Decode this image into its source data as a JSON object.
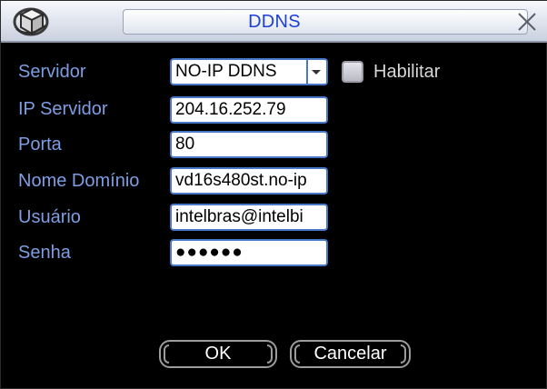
{
  "window": {
    "title": "DDNS",
    "logo_icon": "dahua-cube-logo-icon",
    "close_icon": "close-x-icon"
  },
  "form": {
    "servidor": {
      "label": "Servidor",
      "value": "NO-IP DDNS",
      "arrow_icon": "dropdown-arrow-icon"
    },
    "habilitar": {
      "label": "Habilitar",
      "checked": false
    },
    "ip_servidor": {
      "label": "IP Servidor",
      "value": "204.16.252.79"
    },
    "porta": {
      "label": "Porta",
      "value": "80"
    },
    "nome_dominio": {
      "label": "Nome Domínio",
      "value": "vd16s480st.no-ip"
    },
    "usuario": {
      "label": "Usuário",
      "value": "intelbras@intelbi"
    },
    "senha": {
      "label": "Senha",
      "value": "●●●●●●"
    }
  },
  "buttons": {
    "ok": "OK",
    "cancel": "Cancelar"
  },
  "colors": {
    "label": "#7d9ee3",
    "title": "#1c3fd6",
    "field_border": "#4878c8",
    "background": "#000000"
  }
}
